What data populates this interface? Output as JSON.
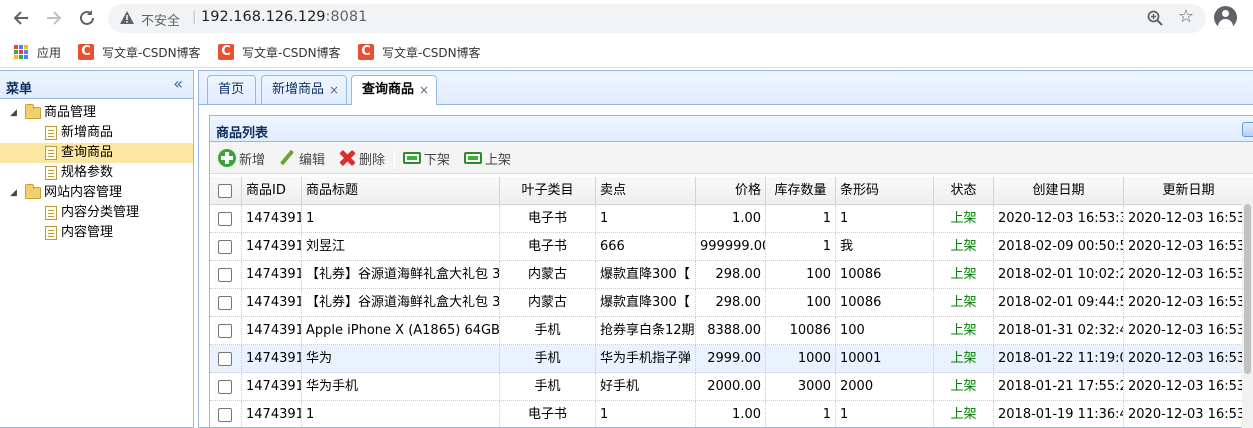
{
  "browser": {
    "insecure_label": "不安全",
    "url_host": "192.168.126.129",
    "url_port": ":8081",
    "bookmarks": [
      {
        "label": "应用",
        "icon": "apps-grid-icon"
      },
      {
        "label": "写文章-CSDN博客",
        "icon": "csdn-icon"
      },
      {
        "label": "写文章-CSDN博客",
        "icon": "csdn-icon"
      },
      {
        "label": "写文章-CSDN博客",
        "icon": "csdn-icon"
      }
    ],
    "csdn_letter": "C"
  },
  "menu": {
    "title": "菜单",
    "collapse_glyph": "«",
    "tree": [
      {
        "label": "商品管理",
        "type": "folder",
        "level": 0,
        "expanded": true
      },
      {
        "label": "新增商品",
        "type": "file",
        "level": 1
      },
      {
        "label": "查询商品",
        "type": "file",
        "level": 1,
        "selected": true
      },
      {
        "label": "规格参数",
        "type": "file",
        "level": 1
      },
      {
        "label": "网站内容管理",
        "type": "folder",
        "level": 0,
        "expanded": true
      },
      {
        "label": "内容分类管理",
        "type": "file",
        "level": 1
      },
      {
        "label": "内容管理",
        "type": "file",
        "level": 1
      }
    ]
  },
  "tabs": [
    {
      "label": "首页",
      "closable": false
    },
    {
      "label": "新增商品",
      "closable": true
    },
    {
      "label": "查询商品",
      "closable": true,
      "active": true
    }
  ],
  "tab_close_glyph": "×",
  "panel": {
    "title": "商品列表"
  },
  "toolbar": {
    "add": "新增",
    "edit": "编辑",
    "delete": "删除",
    "offshelf": "下架",
    "onshelf": "上架"
  },
  "table": {
    "columns": [
      "商品ID",
      "商品标题",
      "叶子类目",
      "卖点",
      "价格",
      "库存数量",
      "条形码",
      "状态",
      "创建日期",
      "更新日期"
    ],
    "rows": [
      {
        "id": "1474391",
        "title": "1",
        "cat": "电子书",
        "sell": "1",
        "price": "1.00",
        "num": "1",
        "barcode": "1",
        "status": "上架",
        "created": "2020-12-03 16:53:3",
        "updated": "2020-12-03 16:53:"
      },
      {
        "id": "1474391",
        "title": "刘昱江",
        "cat": "电子书",
        "sell": "666",
        "price": "999999.00",
        "num": "1",
        "barcode": "我",
        "status": "上架",
        "created": "2018-02-09 00:50:5",
        "updated": "2020-12-03 16:53:"
      },
      {
        "id": "1474391",
        "title": "【礼券】谷源道海鲜礼盒大礼包 3",
        "cat": "内蒙古",
        "sell": "爆款直降300【",
        "price": "298.00",
        "num": "100",
        "barcode": "10086",
        "status": "上架",
        "created": "2018-02-01 10:02:2",
        "updated": "2020-12-03 16:53:"
      },
      {
        "id": "1474391",
        "title": "【礼券】谷源道海鲜礼盒大礼包 3",
        "cat": "内蒙古",
        "sell": "爆款直降300【",
        "price": "298.00",
        "num": "100",
        "barcode": "10086",
        "status": "上架",
        "created": "2018-02-01 09:44:5",
        "updated": "2020-12-03 16:53:"
      },
      {
        "id": "1474391",
        "title": "Apple iPhone X (A1865) 64GB",
        "cat": "手机",
        "sell": "抢券享白条12期",
        "price": "8388.00",
        "num": "10086",
        "barcode": "100",
        "status": "上架",
        "created": "2018-01-31 02:32:4",
        "updated": "2020-12-03 16:53:"
      },
      {
        "id": "1474391",
        "title": "华为",
        "cat": "手机",
        "sell": "华为手机指子弹",
        "price": "2999.00",
        "num": "1000",
        "barcode": "10001",
        "status": "上架",
        "created": "2018-01-22 11:19:0",
        "updated": "2020-12-03 16:53:",
        "highlight": true
      },
      {
        "id": "1474391",
        "title": "华为手机",
        "cat": "手机",
        "sell": "好手机",
        "price": "2000.00",
        "num": "3000",
        "barcode": "2000",
        "status": "上架",
        "created": "2018-01-21 17:55:2",
        "updated": "2020-12-03 16:53:"
      },
      {
        "id": "1474391",
        "title": "1",
        "cat": "电子书",
        "sell": "1",
        "price": "1.00",
        "num": "1",
        "barcode": "1",
        "status": "上架",
        "created": "2018-01-19 11:36:4",
        "updated": "2020-12-03 16:53:"
      }
    ]
  },
  "colors": {
    "panel_border": "#95b8e7",
    "header_gradient_top": "#eff5ff",
    "header_gradient_bottom": "#e0ecff",
    "selected_tree_item": "#fbe7a1",
    "status_green": "#008000",
    "highlight_row": "#eaf2ff"
  }
}
